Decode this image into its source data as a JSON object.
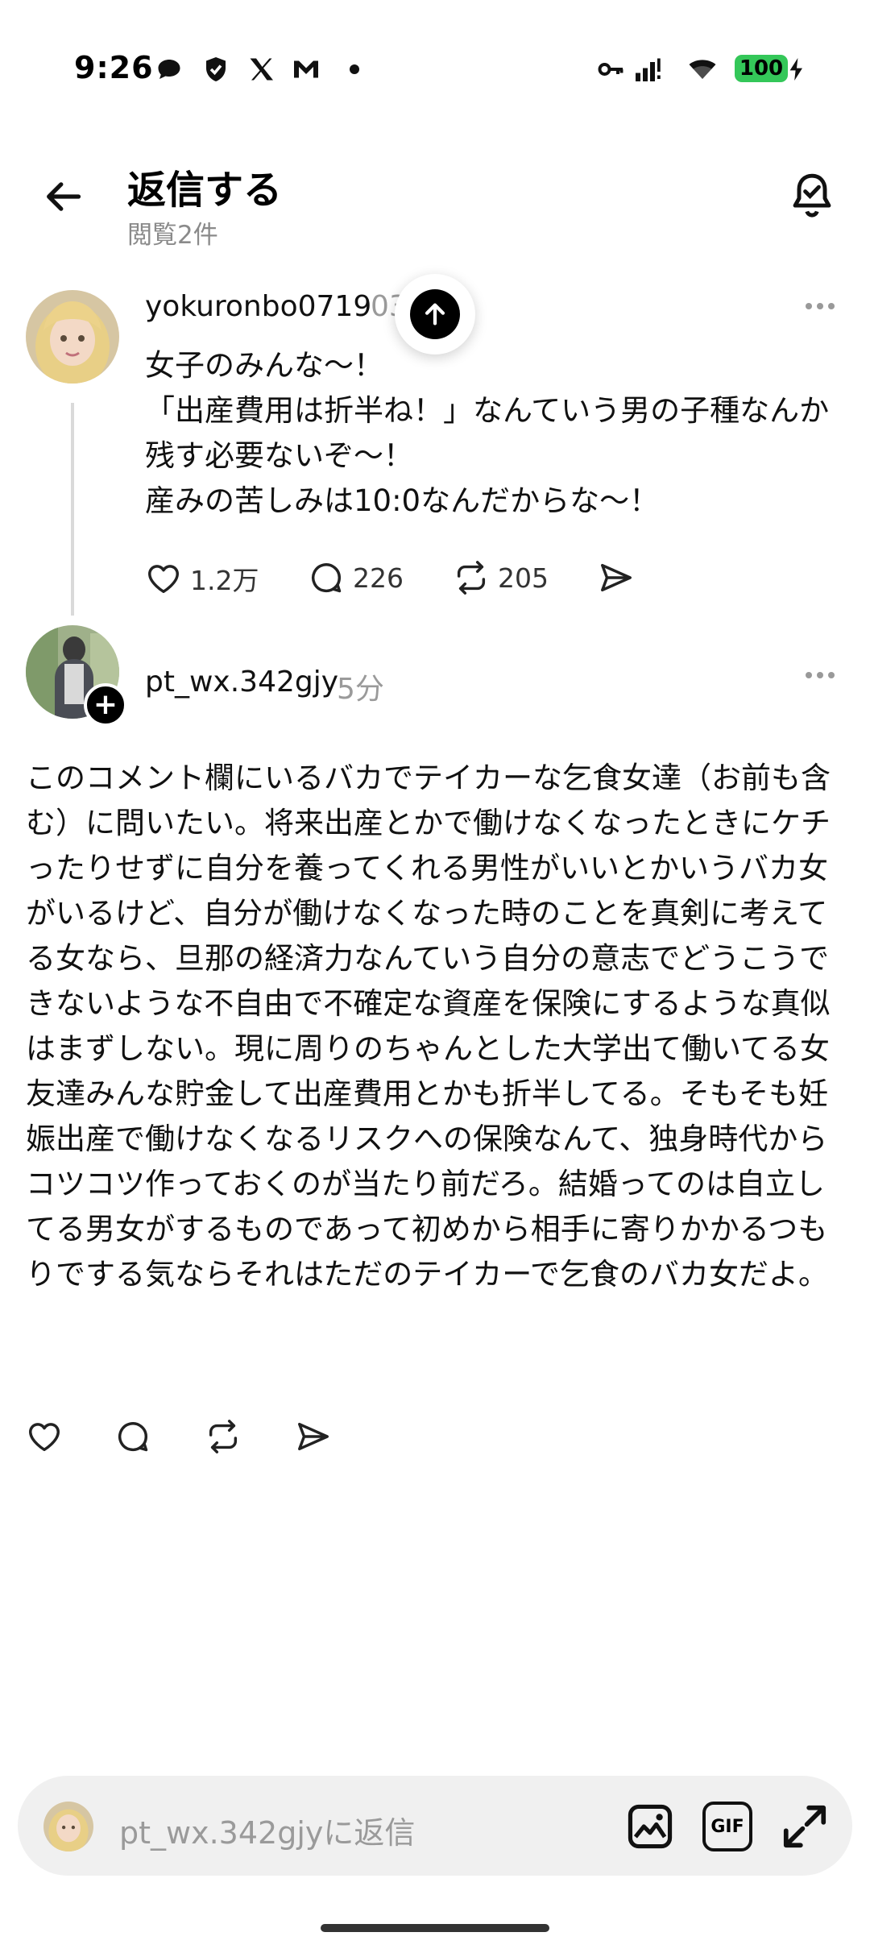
{
  "status_bar": {
    "time": "9:26",
    "battery": "100",
    "left_icons": [
      "chat-bubble-icon",
      "shield-icon",
      "x-logo-icon",
      "mail-icon",
      "dot-icon"
    ],
    "right_icons": [
      "key-icon",
      "signal-icon",
      "wifi-icon",
      "battery-icon",
      "charging-icon"
    ]
  },
  "header": {
    "title": "返信する",
    "subtitle": "閲覧2件"
  },
  "original_post": {
    "username": "yokuronbo0719",
    "time_partial": "03",
    "body": "女子のみんな〜！\n「出産費用は折半ね！」なんていう男の子種なんか残す必要ないぞ〜！\n産みの苦しみは10:0なんだからな〜！",
    "likes": "1.2万",
    "replies": "226",
    "reposts": "205"
  },
  "reply_post": {
    "username": "pt_wx.342gjy",
    "time": "5分",
    "body": "このコメント欄にいるバカでテイカーな乞食女達（お前も含む）に問いたい。将来出産とかで働けなくなったときにケチったりせずに自分を養ってくれる男性がいいとかいうバカ女がいるけど、自分が働けなくなった時のことを真剣に考えてる女なら、旦那の経済力なんていう自分の意志でどうこうできないような不自由で不確定な資産を保険にするような真似はまずしない。現に周りのちゃんとした大学出て働いてる女友達みんな貯金して出産費用とかも折半してる。そもそも妊娠出産で働けなくなるリスクへの保険なんて、独身時代からコツコツ作っておくのが当たり前だろ。結婚ってのは自立してる男女がするものであって初めから相手に寄りかかるつもりでする気ならそれはただのテイカーで乞食のバカ女だよ。"
  },
  "reply_bar": {
    "placeholder": "pt_wx.342gjyに返信",
    "gif_label": "GIF"
  },
  "colors": {
    "battery": "#34c759",
    "muted_text": "#9a9a9a",
    "reply_bar_bg": "#f0f0f0"
  }
}
